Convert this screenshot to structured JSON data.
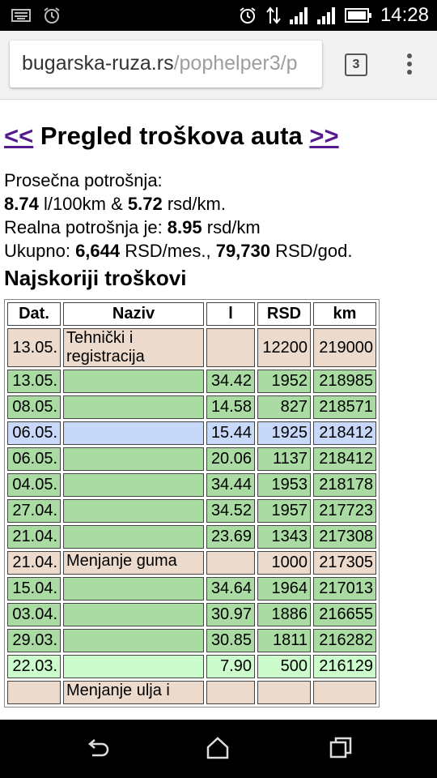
{
  "status_bar": {
    "time": "14:28",
    "left_icons": [
      "keyboard-icon",
      "alarm-clock-icon"
    ],
    "right_icons": [
      "alarm-clock-icon",
      "data-arrows-icon",
      "signal-icon",
      "signal-icon",
      "battery-icon"
    ]
  },
  "browser": {
    "url_host": "bugarska-ruza.rs",
    "url_path": "/pophelper3/p",
    "tab_count": "3"
  },
  "page": {
    "prev_link": "<<",
    "title": "Pregled troškova auta",
    "next_link": ">>",
    "summary": {
      "line1": "Prosečna potrošnja:",
      "fuel_per_100": "8.74",
      "fuel_unit": " l/100km & ",
      "rsd_per_km": "5.72",
      "rsd_per_km_unit": " rsd/km.",
      "real_label": "Realna potrošnja je: ",
      "real_value": "8.95",
      "real_unit": " rsd/km",
      "total_label": "Ukupno: ",
      "monthly": "6,644",
      "monthly_unit": " RSD/mes., ",
      "yearly": "79,730",
      "yearly_unit": " RSD/god."
    },
    "section_title": "Najskoriji troškovi",
    "table": {
      "headers": [
        "Dat.",
        "Naziv",
        "l",
        "RSD",
        "km"
      ],
      "rows": [
        {
          "type": "misc",
          "date": "13.05.",
          "naziv": "Tehnički i registracija",
          "l": "",
          "rsd": "12200",
          "km": "219000"
        },
        {
          "type": "fuel",
          "date": "13.05.",
          "naziv": "",
          "l": "34.42",
          "rsd": "1952",
          "km": "218985"
        },
        {
          "type": "fuel",
          "date": "08.05.",
          "naziv": "",
          "l": "14.58",
          "rsd": "827",
          "km": "218571"
        },
        {
          "type": "blue",
          "date": "06.05.",
          "naziv": "",
          "l": "15.44",
          "rsd": "1925",
          "km": "218412"
        },
        {
          "type": "fuel",
          "date": "06.05.",
          "naziv": "",
          "l": "20.06",
          "rsd": "1137",
          "km": "218412"
        },
        {
          "type": "fuel",
          "date": "04.05.",
          "naziv": "",
          "l": "34.44",
          "rsd": "1953",
          "km": "218178"
        },
        {
          "type": "fuel",
          "date": "27.04.",
          "naziv": "",
          "l": "34.52",
          "rsd": "1957",
          "km": "217723"
        },
        {
          "type": "fuel",
          "date": "21.04.",
          "naziv": "",
          "l": "23.69",
          "rsd": "1343",
          "km": "217308"
        },
        {
          "type": "misc",
          "date": "21.04.",
          "naziv": "Menjanje guma",
          "l": "",
          "rsd": "1000",
          "km": "217305"
        },
        {
          "type": "fuel",
          "date": "15.04.",
          "naziv": "",
          "l": "34.64",
          "rsd": "1964",
          "km": "217013"
        },
        {
          "type": "fuel",
          "date": "03.04.",
          "naziv": "",
          "l": "30.97",
          "rsd": "1886",
          "km": "216655"
        },
        {
          "type": "fuel",
          "date": "29.03.",
          "naziv": "",
          "l": "30.85",
          "rsd": "1811",
          "km": "216282"
        },
        {
          "type": "light",
          "date": "22.03.",
          "naziv": "",
          "l": "7.90",
          "rsd": "500",
          "km": "216129"
        },
        {
          "type": "misc",
          "date": "",
          "naziv": "Menjanje ulja i",
          "l": "",
          "rsd": "",
          "km": ""
        }
      ]
    }
  },
  "nav_bar": {
    "icons": [
      "back-icon",
      "home-icon",
      "recent-apps-icon"
    ]
  }
}
